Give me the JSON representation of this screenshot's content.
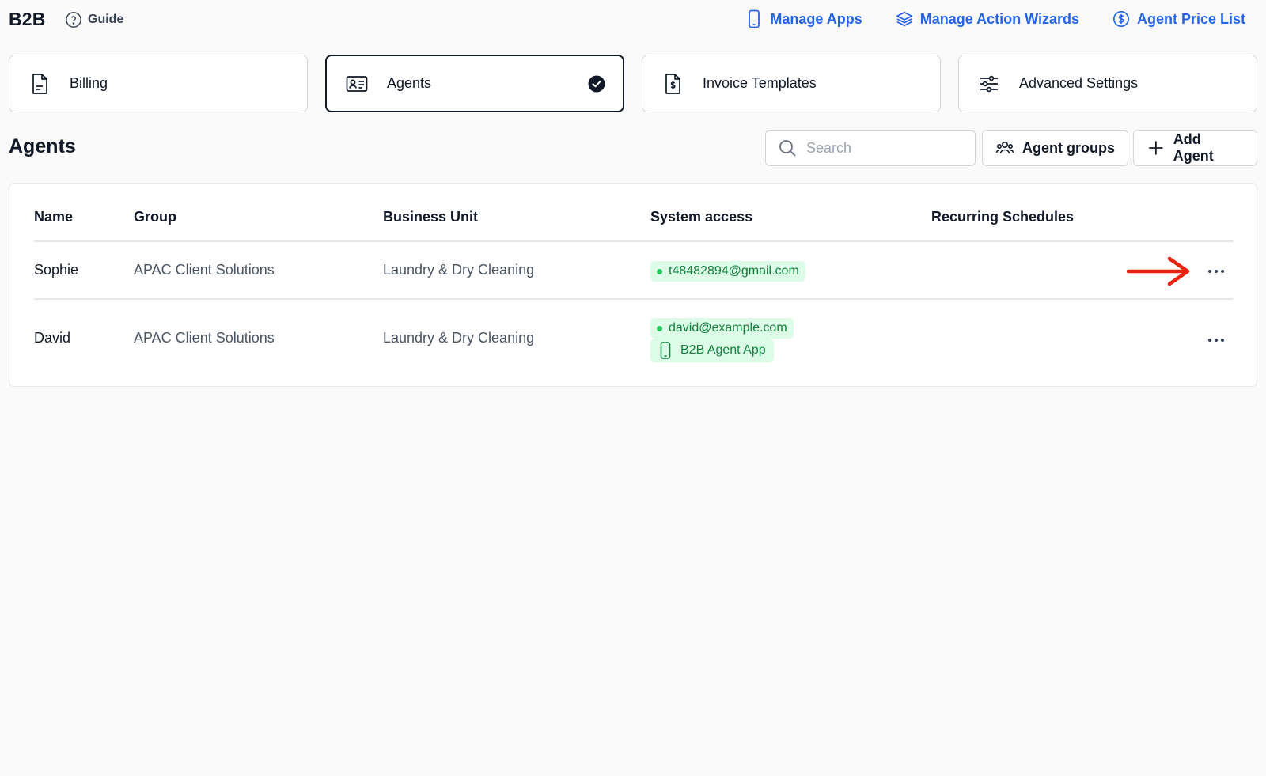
{
  "header": {
    "brand": "B2B",
    "guide_label": "Guide",
    "links": [
      {
        "label": "Manage Apps",
        "icon": "phone-icon"
      },
      {
        "label": "Manage Action Wizards",
        "icon": "layers-icon"
      },
      {
        "label": "Agent Price List",
        "icon": "dollar-circle-icon"
      }
    ]
  },
  "cards": [
    {
      "label": "Billing",
      "icon": "document-icon",
      "active": false
    },
    {
      "label": "Agents",
      "icon": "id-card-icon",
      "active": true
    },
    {
      "label": "Invoice Templates",
      "icon": "invoice-dollar-icon",
      "active": false
    },
    {
      "label": "Advanced Settings",
      "icon": "sliders-icon",
      "active": false
    }
  ],
  "section": {
    "title": "Agents",
    "search_placeholder": "Search",
    "agent_groups_label": "Agent groups",
    "add_agent_label": "Add Agent"
  },
  "table": {
    "columns": [
      "Name",
      "Group",
      "Business Unit",
      "System access",
      "Recurring Schedules"
    ],
    "rows": [
      {
        "name": "Sophie",
        "group": "APAC Client Solutions",
        "business_unit": "Laundry & Dry Cleaning",
        "access_email": "t48482894@gmail.com",
        "access_app": "",
        "recurring": ""
      },
      {
        "name": "David",
        "group": "APAC Client Solutions",
        "business_unit": "Laundry & Dry Cleaning",
        "access_email": "david@example.com",
        "access_app": "B2B Agent App",
        "recurring": ""
      }
    ]
  },
  "colors": {
    "link_blue": "#2563eb",
    "badge_green_bg": "#dcfce7",
    "badge_green_text": "#15803d",
    "annotation_arrow": "#e8220e"
  }
}
